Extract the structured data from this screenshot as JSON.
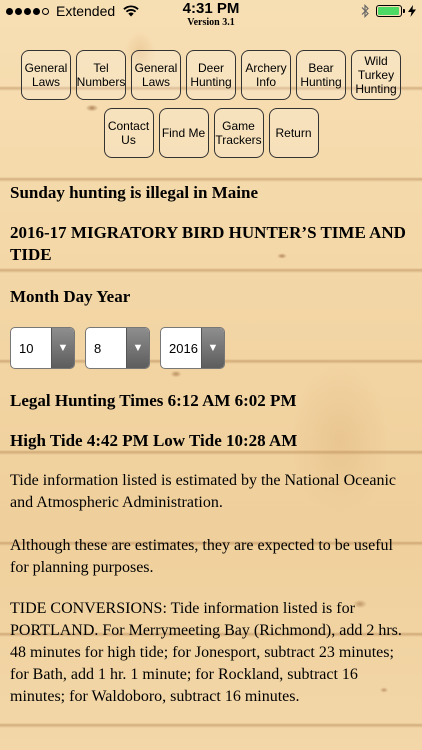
{
  "status_bar": {
    "carrier": "Extended",
    "time": "4:31 PM",
    "version": "Version 3.1",
    "signal_dots_filled": 4,
    "signal_dots_total": 5,
    "battery_level": 0.95,
    "icons": [
      "wifi-icon",
      "bluetooth-icon",
      "battery-icon",
      "charging-bolt-icon"
    ]
  },
  "nav": {
    "row1": [
      "General\nLaws",
      "Tel\nNumbers",
      "General\nLaws",
      "Deer\nHunting",
      "Archery\nInfo",
      "Bear\nHunting",
      "Wild\nTurkey\nHunting"
    ],
    "row2": [
      "Contact\nUs",
      "Find Me",
      "Game\nTrackers",
      "Return"
    ]
  },
  "content": {
    "sunday_notice": "Sunday hunting is illegal in Maine",
    "migratory_title": "2016-17 MIGRATORY BIRD HUNTER’S TIME AND TIDE",
    "date_label": "Month Day Year",
    "month_value": "10",
    "day_value": "8",
    "year_value": "2016",
    "legal_hunting": "Legal Hunting Times 6:12 AM 6:02 PM",
    "tide_times": "High Tide 4:42 PM Low Tide 10:28 AM",
    "tide_source": "Tide information listed is estimated by the National Oceanic and Atmospheric Administration.",
    "estimates_note": "Although these are estimates, they are expected to be useful for planning purposes.",
    "conversions": "TIDE CONVERSIONS: Tide information listed is for PORTLAND. For Merrymeeting Bay (Richmond), add 2 hrs. 48 minutes for high tide; for Jonesport, subtract 23 minutes; for Bath, add 1 hr. 1 minute; for Rockland, subtract 16 minutes; for Waldoboro, subtract 16 minutes."
  },
  "colors": {
    "battery": "#4cd964",
    "wood": "#f3d6a5"
  }
}
